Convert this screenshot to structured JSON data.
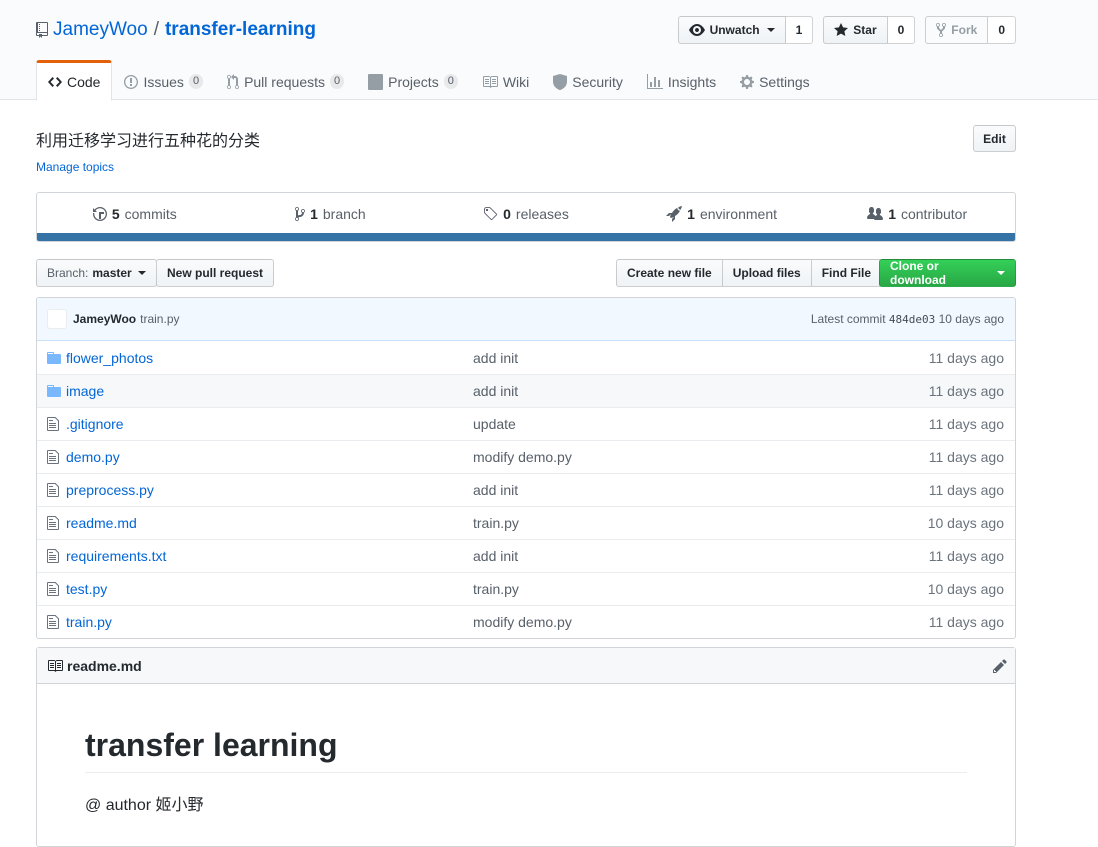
{
  "repo": {
    "owner": "JameyWoo",
    "separator": "/",
    "name": "transfer-learning"
  },
  "actions": {
    "watch_label": "Unwatch",
    "watch_count": "1",
    "star_label": "Star",
    "star_count": "0",
    "fork_label": "Fork",
    "fork_count": "0"
  },
  "nav": {
    "code": "Code",
    "issues": "Issues",
    "issues_count": "0",
    "pulls": "Pull requests",
    "pulls_count": "0",
    "projects": "Projects",
    "projects_count": "0",
    "wiki": "Wiki",
    "security": "Security",
    "insights": "Insights",
    "settings": "Settings"
  },
  "description": "利用迁移学习进行五种花的分类",
  "manage_topics": "Manage topics",
  "edit_label": "Edit",
  "summary": {
    "commits_num": "5",
    "commits_label": "commits",
    "branch_num": "1",
    "branch_label": "branch",
    "releases_num": "0",
    "releases_label": "releases",
    "env_num": "1",
    "env_label": "environment",
    "contrib_num": "1",
    "contrib_label": "contributor",
    "language_color": "#3572A5"
  },
  "file_nav": {
    "branch_prefix": "Branch:",
    "branch_name": "master",
    "new_pr": "New pull request",
    "create_file": "Create new file",
    "upload_files": "Upload files",
    "find_file": "Find File",
    "clone": "Clone or download"
  },
  "latest_commit": {
    "author": "JameyWoo",
    "message": "train.py",
    "prefix": "Latest commit",
    "sha": "484de03",
    "age": "10 days ago"
  },
  "files": [
    {
      "name": "flower_photos",
      "type": "dir",
      "message": "add init",
      "age": "11 days ago"
    },
    {
      "name": "image",
      "type": "dir",
      "message": "add init",
      "age": "11 days ago"
    },
    {
      "name": ".gitignore",
      "type": "file",
      "message": "update",
      "age": "11 days ago"
    },
    {
      "name": "demo.py",
      "type": "file",
      "message": "modify demo.py",
      "age": "11 days ago"
    },
    {
      "name": "preprocess.py",
      "type": "file",
      "message": "add init",
      "age": "11 days ago"
    },
    {
      "name": "readme.md",
      "type": "file",
      "message": "train.py",
      "age": "10 days ago"
    },
    {
      "name": "requirements.txt",
      "type": "file",
      "message": "add init",
      "age": "11 days ago"
    },
    {
      "name": "test.py",
      "type": "file",
      "message": "train.py",
      "age": "10 days ago"
    },
    {
      "name": "train.py",
      "type": "file",
      "message": "modify demo.py",
      "age": "11 days ago"
    }
  ],
  "readme": {
    "filename": "readme.md",
    "heading": "transfer learning",
    "author_line": "@ author 姬小野"
  }
}
